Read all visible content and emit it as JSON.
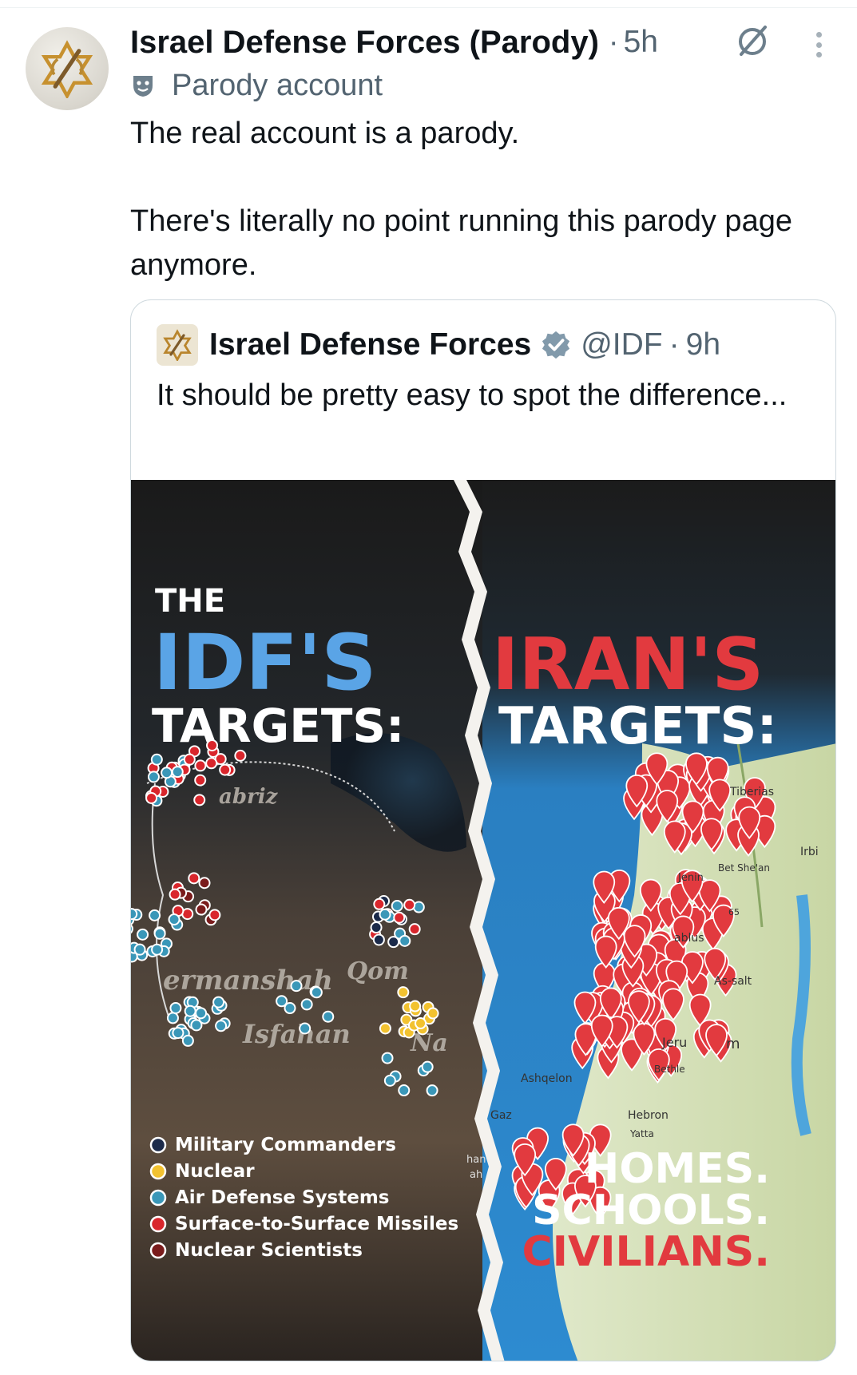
{
  "post": {
    "display_name": "Israel Defense Forces (Parody)",
    "separator": "·",
    "time": "5h",
    "label": "Parody account",
    "text_line_1": "The real account is a parody.",
    "text_line_2": "There's literally no point running this parody page anymore."
  },
  "quote": {
    "display_name": "Israel Defense Forces",
    "handle": "@IDF",
    "separator": "·",
    "time": "9h",
    "text": "It should be pretty easy to spot the difference..."
  },
  "media": {
    "left_heading_small": "THE",
    "left_heading_big": "IDF'S",
    "left_heading_sub": "TARGETS:",
    "right_heading_big": "IRAN'S",
    "right_heading_sub": "TARGETS:",
    "legend": [
      {
        "label": "Military Commanders",
        "color": "#1b2a4a"
      },
      {
        "label": "Nuclear",
        "color": "#f2c230"
      },
      {
        "label": "Air Defense Systems",
        "color": "#3a97b8"
      },
      {
        "label": "Surface-to-Surface Missiles",
        "color": "#d9262c"
      },
      {
        "label": "Nuclear Scientists",
        "color": "#7a1c1c"
      }
    ],
    "left_places": [
      "abriz",
      "ermanshah",
      "Qom",
      "Isfahan",
      "Na"
    ],
    "right_places": [
      "Tiberias",
      "Irbi",
      "Bet She'an",
      "Jenin",
      "65",
      "ablus",
      "As-salt",
      "Jeru",
      "Bethle",
      "Ashqelon",
      "Gaz",
      "Hebron",
      "Yatta",
      "m",
      "han",
      "ah"
    ],
    "right_footer_1": "HOMES.",
    "right_footer_2": "SCHOOLS.",
    "right_footer_3": "CIVILIANS."
  },
  "colors": {
    "accent_blue": "#5aa4e6",
    "alert_red": "#e23a3f",
    "verified": "#829aab",
    "muted_text": "#536471"
  },
  "icons": [
    "idf-emblem-icon",
    "grok-icon",
    "more-icon",
    "parody-mask-icon",
    "verified-badge-icon"
  ]
}
